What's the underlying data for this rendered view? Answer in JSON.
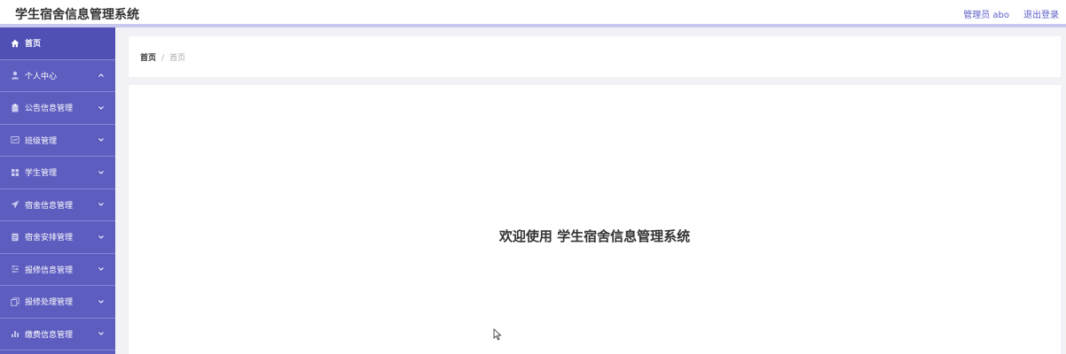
{
  "app": {
    "title": "学生宿舍信息管理系统"
  },
  "header": {
    "user_label": "管理员 abo",
    "logout_label": "退出登录"
  },
  "sidebar": {
    "items": [
      {
        "label": "首页",
        "icon": "home-icon"
      },
      {
        "label": "个人中心",
        "icon": "user-icon"
      },
      {
        "label": "公告信息管理",
        "icon": "clipboard-icon"
      },
      {
        "label": "班级管理",
        "icon": "chart-icon"
      },
      {
        "label": "学生管理",
        "icon": "grid-icon"
      },
      {
        "label": "宿舍信息管理",
        "icon": "send-icon"
      },
      {
        "label": "宿舍安排管理",
        "icon": "document-icon"
      },
      {
        "label": "报修信息管理",
        "icon": "sliders-icon"
      },
      {
        "label": "报修处理管理",
        "icon": "copy-icon"
      },
      {
        "label": "缴费信息管理",
        "icon": "bar-chart-icon"
      }
    ]
  },
  "breadcrumb": {
    "home": "首页",
    "separator": "/",
    "current": "首页"
  },
  "main": {
    "welcome": "欢迎使用 学生宿舍信息管理系统"
  },
  "colors": {
    "sidebar_bg": "#5d5dc0",
    "accent": "#5e5ec8",
    "page_bg": "#f2f2f6"
  }
}
